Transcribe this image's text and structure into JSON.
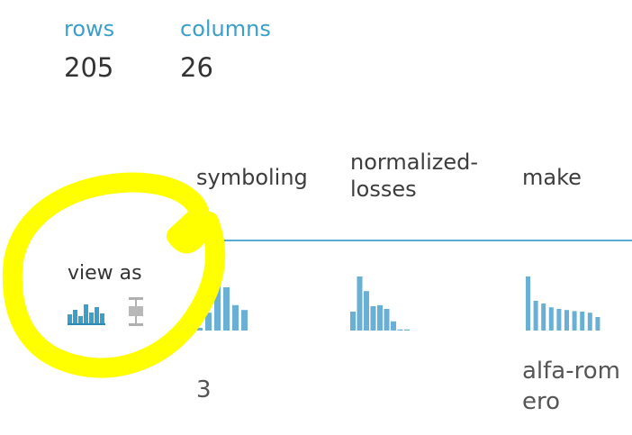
{
  "summary": {
    "rows_label": "rows",
    "rows_value": "205",
    "columns_label": "columns",
    "columns_value": "26"
  },
  "view_as": {
    "label": "view as",
    "options": [
      "histogram-icon",
      "boxplot-icon"
    ],
    "selected": "histogram-icon"
  },
  "columns": [
    {
      "header": "symboling",
      "first_value": "3",
      "histogram": [
        0.05,
        0.33,
        1.0,
        0.8,
        0.47,
        0.38
      ]
    },
    {
      "header": "normalized-losses",
      "first_value": "",
      "histogram": [
        0.35,
        1.0,
        0.73,
        0.45,
        0.47,
        0.4,
        0.17,
        0.02,
        0.02
      ]
    },
    {
      "header": "make",
      "first_value": "alfa-romero",
      "histogram": [
        1.0,
        0.55,
        0.5,
        0.43,
        0.4,
        0.38,
        0.36,
        0.35,
        0.33,
        0.25
      ]
    }
  ],
  "colors": {
    "accent": "#3a9fc9",
    "bar": "#6ab0d6",
    "highlight": "#ffff00",
    "divider": "#5aaad6"
  }
}
